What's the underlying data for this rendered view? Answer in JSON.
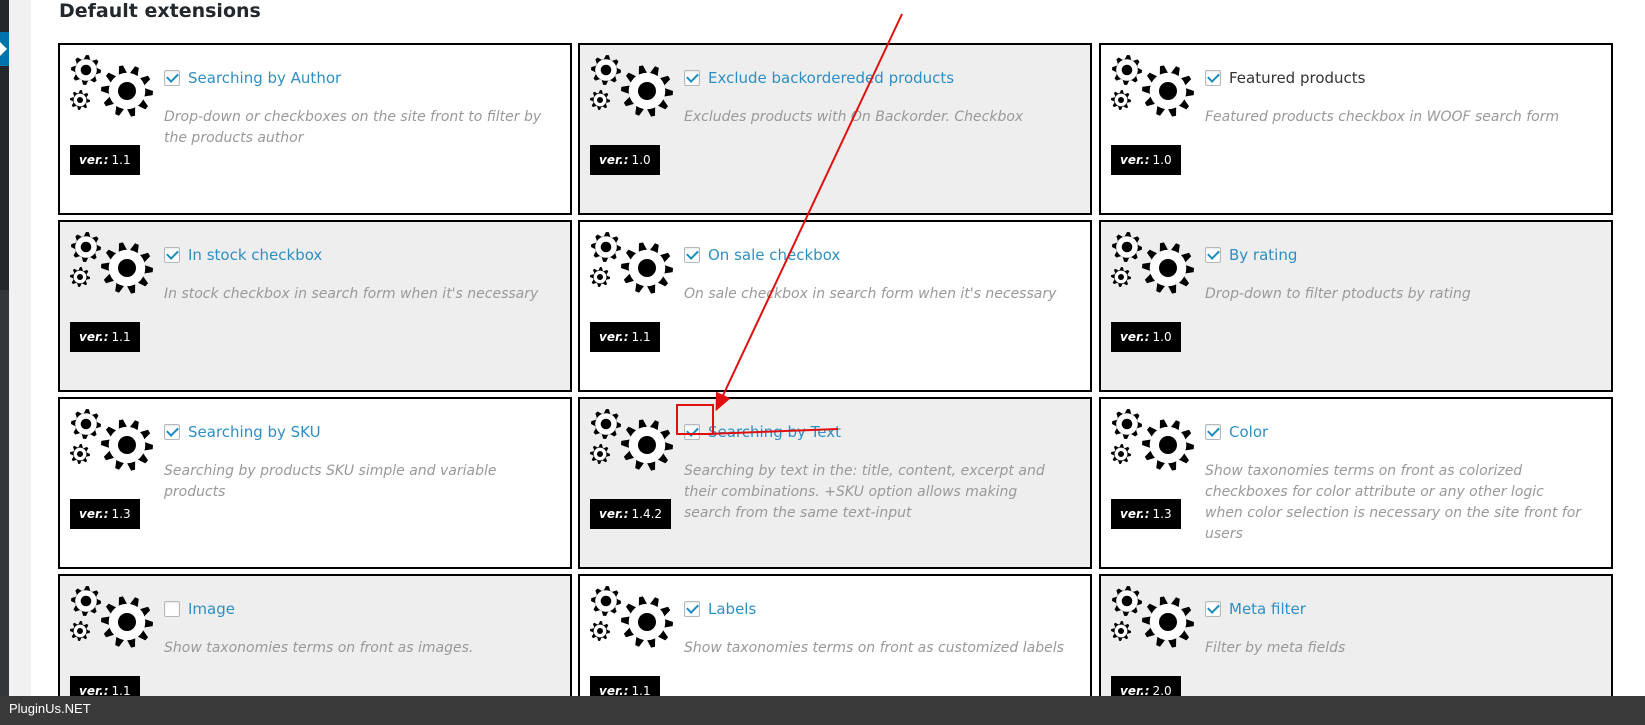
{
  "section": {
    "title": "Default extensions"
  },
  "version_label": "ver.:",
  "extensions": [
    {
      "title": "Searching by Author",
      "desc": "Drop-down or checkboxes on the site front to filter by the products author",
      "version": "1.1",
      "checked": true,
      "grey": false,
      "title_color": "link"
    },
    {
      "title": "Exclude backordereded products",
      "desc": "Excludes products with On Backorder. Checkbox",
      "version": "1.0",
      "checked": true,
      "grey": true,
      "title_color": "link"
    },
    {
      "title": "Featured products",
      "desc": "Featured products checkbox in WOOF search form",
      "version": "1.0",
      "checked": true,
      "grey": false,
      "title_color": "dark"
    },
    {
      "title": "In stock checkbox",
      "desc": "In stock checkbox in search form when it's necessary",
      "version": "1.1",
      "checked": true,
      "grey": true,
      "title_color": "link"
    },
    {
      "title": "On sale checkbox",
      "desc": "On sale checkbox in search form when it's necessary",
      "version": "1.1",
      "checked": true,
      "grey": false,
      "title_color": "link"
    },
    {
      "title": "By rating",
      "desc": "Drop-down to filter ptoducts by rating",
      "version": "1.0",
      "checked": true,
      "grey": true,
      "title_color": "link"
    },
    {
      "title": "Searching by SKU",
      "desc": "Searching by products SKU simple and variable products",
      "version": "1.3",
      "checked": true,
      "grey": false,
      "title_color": "link"
    },
    {
      "title": "Searching by Text",
      "desc": "Searching by text in the: title, content, excerpt and their combinations. +SKU option allows making search from the same text-input",
      "version": "1.4.2",
      "checked": true,
      "grey": true,
      "title_color": "link"
    },
    {
      "title": "Color",
      "desc": "Show taxonomies terms on front as colorized checkboxes for color attribute or any other logic when color selection is necessary on the site front for users",
      "version": "1.3",
      "checked": true,
      "grey": false,
      "title_color": "link"
    },
    {
      "title": "Image",
      "desc": "Show taxonomies terms on front as images.",
      "version": "1.1",
      "checked": false,
      "grey": true,
      "title_color": "link"
    },
    {
      "title": "Labels",
      "desc": "Show taxonomies terms on front as customized labels",
      "version": "1.1",
      "checked": true,
      "grey": false,
      "title_color": "link"
    },
    {
      "title": "Meta filter",
      "desc": "Filter by meta fields",
      "version": "2.0",
      "checked": true,
      "grey": true,
      "title_color": "link"
    }
  ],
  "footer": {
    "text": "PluginUs.NET"
  },
  "colors": {
    "link": "#2e8fc4",
    "annotation": "#e01010",
    "grey_card": "#eeeeee"
  },
  "icons": {
    "extension": "gears-icon",
    "checkbox": "checkmark-icon"
  }
}
